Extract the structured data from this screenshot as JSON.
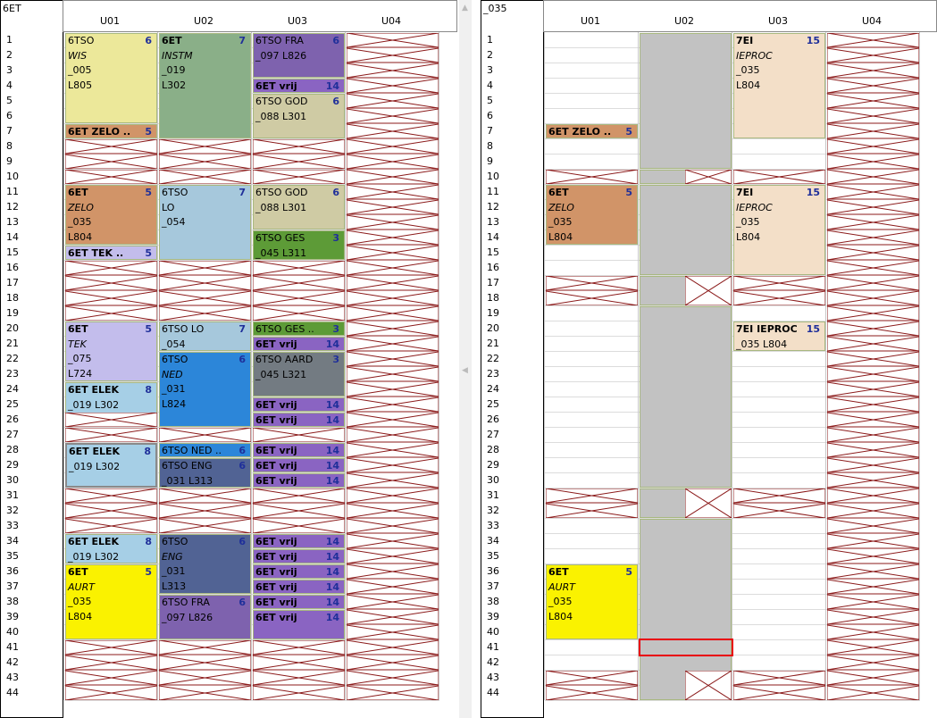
{
  "left_pane": {
    "title": "6ET"
  },
  "right_pane": {
    "title": "_035"
  },
  "columns": [
    "U01",
    "U02",
    "U03",
    "U04"
  ],
  "rows": [
    "1",
    "2",
    "3",
    "4",
    "5",
    "6",
    "7",
    "8",
    "9",
    "10",
    "11",
    "12",
    "13",
    "14",
    "15",
    "16",
    "17",
    "18",
    "19",
    "20",
    "21",
    "22",
    "23",
    "24",
    "25",
    "26",
    "27",
    "28",
    "29",
    "30",
    "31",
    "32",
    "33",
    "34",
    "35",
    "36",
    "37",
    "38",
    "39",
    "40",
    "41",
    "42",
    "43",
    "44"
  ],
  "colors": {
    "wis": "#ece89a",
    "instm": "#8aaf88",
    "fra": "#7e62ae",
    "vrij": "#8a64c2",
    "god": "#cfcba4",
    "zelo": "#d19468",
    "lo": "#a6c8dc",
    "ges": "#5d9b37",
    "tek": "#c3bdec",
    "ned": "#2c86d9",
    "aard": "#737b82",
    "elek": "#a6cfe6",
    "eng": "#516394",
    "aurt": "#faf200",
    "iep": "#f3dfc8",
    "gray": "#c2c2c2",
    "selection": "#e8000d",
    "cross": "#8b1a1a"
  },
  "left_blocks": [
    {
      "lines": [
        "6TSO",
        "WIS",
        "_005",
        "L805"
      ],
      "count": "6",
      "color": "wis"
    },
    {
      "lines": [
        "6ET  ZELO .."
      ],
      "count": "5",
      "color": "zelo"
    },
    {
      "lines": [
        "6ET",
        "INSTM",
        "_019",
        "L302"
      ],
      "count": "7",
      "color": "instm"
    },
    {
      "lines": [
        "6TSO   FRA",
        "_097  L826"
      ],
      "count": "6",
      "color": "fra"
    },
    {
      "lines": [
        "6ET  vrij"
      ],
      "count": "14",
      "color": "vrij"
    },
    {
      "lines": [
        "6TSO   GOD",
        "_088  L301"
      ],
      "count": "6",
      "color": "god"
    },
    {
      "lines": [
        "6ET",
        "ZELO",
        "_035",
        "L804"
      ],
      "count": "5",
      "color": "zelo"
    },
    {
      "lines": [
        "6ET  TEK .."
      ],
      "count": "5",
      "color": "tek"
    },
    {
      "lines": [
        "6TSO",
        "LO",
        "_054"
      ],
      "count": "7",
      "color": "lo"
    },
    {
      "lines": [
        "6TSO   GOD",
        "_088  L301"
      ],
      "count": "6",
      "color": "god"
    },
    {
      "lines": [
        "6TSO   GES",
        "_045  L311"
      ],
      "count": "3",
      "color": "ges"
    },
    {
      "lines": [
        "6ET",
        "TEK",
        "_075",
        "L724"
      ],
      "count": "5",
      "color": "tek"
    },
    {
      "lines": [
        "6ET  ELEK",
        "_019  L302"
      ],
      "count": "8",
      "color": "elek"
    },
    {
      "lines": [
        "6TSO   LO",
        "_054"
      ],
      "count": "7",
      "color": "lo"
    },
    {
      "lines": [
        "6TSO",
        "NED",
        "_031",
        "L824"
      ],
      "count": "6",
      "color": "ned"
    },
    {
      "lines": [
        "6TSO   GES .."
      ],
      "count": "3",
      "color": "ges"
    },
    {
      "lines": [
        "6ET  vrij"
      ],
      "count": "14",
      "color": "vrij"
    },
    {
      "lines": [
        "6TSO   AARD",
        "_045  L321"
      ],
      "count": "3",
      "color": "aard"
    },
    {
      "lines": [
        "6ET  vrij"
      ],
      "count": "14",
      "color": "vrij"
    },
    {
      "lines": [
        "6ET  vrij"
      ],
      "count": "14",
      "color": "vrij"
    },
    {
      "lines": [
        "6ET  ELEK",
        "_019  L302"
      ],
      "count": "8",
      "color": "elek"
    },
    {
      "lines": [
        "6TSO   NED .."
      ],
      "count": "6",
      "color": "ned"
    },
    {
      "lines": [
        "6TSO   ENG",
        "_031  L313"
      ],
      "count": "6",
      "color": "eng"
    },
    {
      "lines": [
        "6ET  vrij"
      ],
      "count": "14",
      "color": "vrij"
    },
    {
      "lines": [
        "6ET  vrij"
      ],
      "count": "14",
      "color": "vrij"
    },
    {
      "lines": [
        "6ET  vrij"
      ],
      "count": "14",
      "color": "vrij"
    },
    {
      "lines": [
        "6ET  ELEK",
        "_019  L302"
      ],
      "count": "8",
      "color": "elek"
    },
    {
      "lines": [
        "6ET",
        "AURT",
        "_035",
        "L804"
      ],
      "count": "5",
      "color": "aurt"
    },
    {
      "lines": [
        "6TSO",
        "ENG",
        "_031",
        "L313"
      ],
      "count": "6",
      "color": "eng"
    },
    {
      "lines": [
        "6TSO   FRA",
        "_097  L826"
      ],
      "count": "6",
      "color": "fra"
    },
    {
      "lines": [
        "6ET  vrij"
      ],
      "count": "14",
      "color": "vrij"
    },
    {
      "lines": [
        "6ET  vrij"
      ],
      "count": "14",
      "color": "vrij"
    },
    {
      "lines": [
        "6ET  vrij"
      ],
      "count": "14",
      "color": "vrij"
    },
    {
      "lines": [
        "6ET  vrij"
      ],
      "count": "14",
      "color": "vrij"
    },
    {
      "lines": [
        "6ET  vrij"
      ],
      "count": "14",
      "color": "vrij"
    },
    {
      "lines": [
        "6ET  vrij"
      ],
      "count": "14",
      "color": "vrij"
    }
  ],
  "right_blocks": [
    {
      "lines": [
        "6ET  ZELO .."
      ],
      "count": "5",
      "color": "zelo"
    },
    {
      "lines": [
        "6ET",
        "ZELO",
        "_035",
        "L804"
      ],
      "count": "5",
      "color": "zelo"
    },
    {
      "lines": [
        "6ET",
        "AURT",
        "_035",
        "L804"
      ],
      "count": "5",
      "color": "aurt"
    },
    {
      "lines": [],
      "count": "",
      "color": "gray"
    },
    {
      "lines": [],
      "count": "",
      "color": "gray"
    },
    {
      "lines": [],
      "count": "",
      "color": "gray"
    },
    {
      "lines": [],
      "count": "",
      "color": "gray"
    },
    {
      "lines": [],
      "count": "",
      "color": "gray"
    },
    {
      "lines": [],
      "count": "",
      "color": "gray"
    },
    {
      "lines": [],
      "count": "",
      "color": "gray"
    },
    {
      "lines": [
        "7EI",
        "IEPROC",
        "_035",
        "L804"
      ],
      "count": "15",
      "color": "iep"
    },
    {
      "lines": [
        "7EI",
        "IEPROC",
        "_035",
        "L804"
      ],
      "count": "15",
      "color": "iep"
    },
    {
      "lines": [
        "7EI  IEPROC",
        "_035  L804"
      ],
      "count": "15",
      "color": "iep"
    }
  ]
}
